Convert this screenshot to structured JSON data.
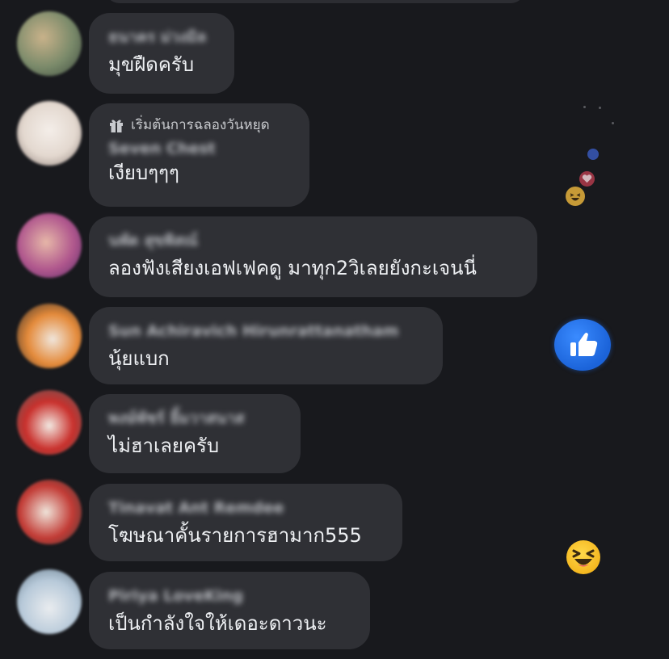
{
  "comments": [
    {
      "name": "ธนาคร ม่วงมิล",
      "text": "มุขฝืดครับ",
      "badge": null
    },
    {
      "name": "Seven Chest",
      "text": "เงียบๆๆๆ",
      "badge": "เริ่มต้นการฉลองวันหยุด"
    },
    {
      "name": "นพัด สุขพิสณ์",
      "text": "ลองฟังเสียงเอฟเฟคดู มาทุก2วิเลยยังกะเจนนี่",
      "badge": null
    },
    {
      "name": "Sun Achiravich Hirunrattanatham",
      "text": "นุ้ยแบก",
      "badge": null
    },
    {
      "name": "พงษ์พัชร์ ยิ้มวาสนาส",
      "text": "ไม่ฮาเลยครับ",
      "badge": null
    },
    {
      "name": "Tinavat Ant Remdee",
      "text": "โฆษณาคั้นรายการฮามาก555",
      "badge": null
    },
    {
      "name": "Piriya LoveKing",
      "text": "เป็นกำลังใจให้เดอะดาวนะ",
      "badge": null
    }
  ],
  "reactions": [
    {
      "type": "like-icon"
    },
    {
      "type": "heart-icon"
    },
    {
      "type": "haha-icon"
    },
    {
      "type": "like-icon"
    },
    {
      "type": "haha-icon"
    }
  ],
  "colors": {
    "background": "#18191d",
    "bubble": "#2f3035",
    "like_blue": "#1b63d9",
    "haha_yellow": "#f3b51d"
  }
}
